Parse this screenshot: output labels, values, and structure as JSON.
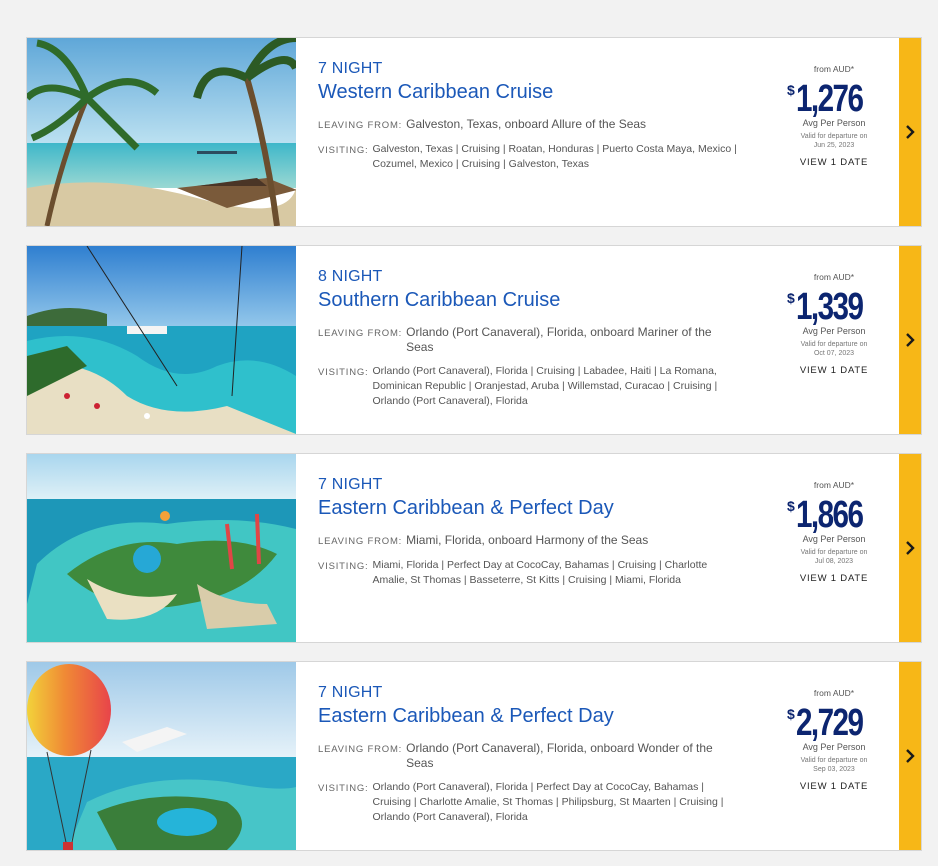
{
  "colors": {
    "accent_blue": "#1b58b8",
    "price_navy": "#0c2570",
    "go_tab_yellow": "#f7b717",
    "card_border": "#d6d6d6",
    "page_bg": "#f2f2f2"
  },
  "cruises": [
    {
      "image": "palm-beach-photo",
      "nights": "7 NIGHT",
      "title": "Western Caribbean Cruise",
      "leaving_label": "LEAVING FROM:",
      "leaving_value": "Galveston, Texas, onboard Allure of the Seas",
      "visiting_label": "VISITING:",
      "visiting_value": "Galveston, Texas  |  Cruising  |  Roatan, Honduras  |  Puerto Costa Maya, Mexico  |  Cozumel, Mexico  |  Cruising  |  Galveston, Texas",
      "from_label": "from AUD*",
      "currency": "$",
      "price": "1,276",
      "avg_label": "Avg Per Person",
      "valid_line1": "Valid for departure on",
      "valid_line2": "Jun 25, 2023",
      "view_label": "VIEW 1 DATE",
      "arrow_icon": "chevron-right-icon"
    },
    {
      "image": "zipline-beach-photo",
      "nights": "8 NIGHT",
      "title": "Southern Caribbean Cruise",
      "leaving_label": "LEAVING FROM:",
      "leaving_value": "Orlando (Port Canaveral), Florida, onboard Mariner of the Seas",
      "visiting_label": "VISITING:",
      "visiting_value": "Orlando (Port Canaveral), Florida  |  Cruising  |  Labadee, Haiti  |  La Romana, Dominican Republic  |  Oranjestad, Aruba  |  Willemstad, Curacao  |  Cruising  |  Orlando (Port Canaveral), Florida",
      "from_label": "from AUD*",
      "currency": "$",
      "price": "1,339",
      "avg_label": "Avg Per Person",
      "valid_line1": "Valid for departure on",
      "valid_line2": "Oct 07, 2023",
      "view_label": "VIEW 1 DATE",
      "arrow_icon": "chevron-right-icon"
    },
    {
      "image": "private-island-aerial-photo",
      "nights": "7 NIGHT",
      "title": "Eastern Caribbean & Perfect Day",
      "leaving_label": "LEAVING FROM:",
      "leaving_value": "Miami, Florida, onboard Harmony of the Seas",
      "visiting_label": "VISITING:",
      "visiting_value": "Miami, Florida  |  Perfect Day at CocoCay, Bahamas  |  Cruising  |  Charlotte Amalie, St Thomas  |  Basseterre, St Kitts  |  Cruising  |  Miami, Florida",
      "from_label": "from AUD*",
      "currency": "$",
      "price": "1,866",
      "avg_label": "Avg Per Person",
      "valid_line1": "Valid for departure on",
      "valid_line2": "Jul 08, 2023",
      "view_label": "VIEW 1 DATE",
      "arrow_icon": "chevron-right-icon"
    },
    {
      "image": "hot-air-balloon-island-photo",
      "nights": "7 NIGHT",
      "title": "Eastern Caribbean & Perfect Day",
      "leaving_label": "LEAVING FROM:",
      "leaving_value": "Orlando (Port Canaveral), Florida, onboard Wonder of the Seas",
      "visiting_label": "VISITING:",
      "visiting_value": "Orlando (Port Canaveral), Florida  |  Perfect Day at CocoCay, Bahamas  |  Cruising  |  Charlotte Amalie, St Thomas  |  Philipsburg, St Maarten  |  Cruising  |  Orlando (Port Canaveral), Florida",
      "from_label": "from AUD*",
      "currency": "$",
      "price": "2,729",
      "avg_label": "Avg Per Person",
      "valid_line1": "Valid for departure on",
      "valid_line2": "Sep 03, 2023",
      "view_label": "VIEW 1 DATE",
      "arrow_icon": "chevron-right-icon"
    }
  ]
}
